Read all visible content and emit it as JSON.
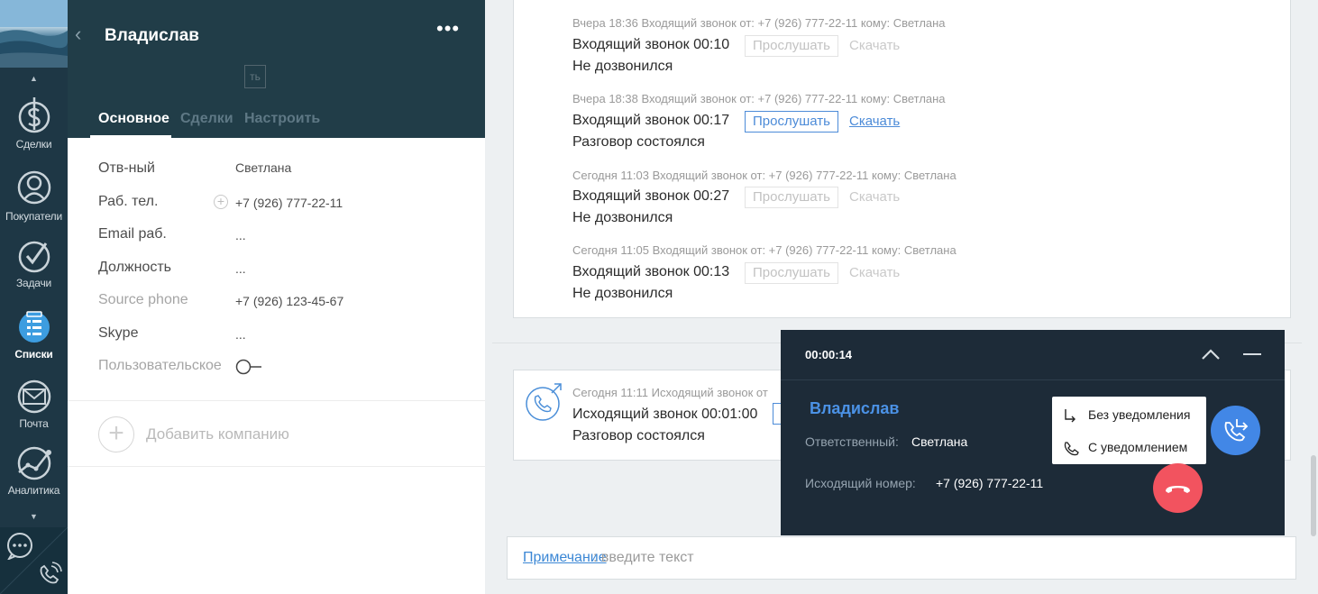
{
  "nav": {
    "items": [
      {
        "label": "Сделки",
        "icon": "dollar-icon"
      },
      {
        "label": "Покупатели",
        "icon": "customers-icon"
      },
      {
        "label": "Задачи",
        "icon": "tasks-icon"
      },
      {
        "label": "Списки",
        "icon": "lists-icon",
        "active": true
      },
      {
        "label": "Почта",
        "icon": "mail-icon"
      },
      {
        "label": "Аналитика",
        "icon": "analytics-icon"
      }
    ],
    "colors": {
      "bg": "#1e3745",
      "active_icon": "#3d9de0"
    }
  },
  "card": {
    "title": "Владислав",
    "ghost_button": "ть",
    "tabs": [
      "Основное",
      "Сделки",
      "Настроить"
    ],
    "fields": [
      {
        "label": "Отв-ный",
        "value": "Светлана"
      },
      {
        "label": "Раб. тел.",
        "value": "+7 (926) 777-22-11"
      },
      {
        "label": "Email раб.",
        "value": "..."
      },
      {
        "label": "Должность",
        "value": "..."
      },
      {
        "label": "Source phone",
        "value": "+7 (926) 123-45-67"
      },
      {
        "label": "Skype",
        "value": "..."
      },
      {
        "label": "Пользовательское",
        "value": ""
      }
    ],
    "add_company": "Добавить компанию"
  },
  "feed": {
    "calls": [
      {
        "meta": "Вчера 18:36 Входящий звонок от: +7 (926) 777-22-11 кому: Светлана",
        "title": "Входящий звонок 00:10",
        "listen": "Прослушать",
        "download": "Скачать",
        "status": "Не дозвонился",
        "active": false
      },
      {
        "meta": "Вчера 18:38 Входящий звонок от: +7 (926) 777-22-11 кому: Светлана",
        "title": "Входящий звонок 00:17",
        "listen": "Прослушать",
        "download": "Скачать",
        "status": "Разговор состоялся",
        "active": true
      },
      {
        "meta": "Сегодня 11:03 Входящий звонок от: +7 (926) 777-22-11 кому: Светлана",
        "title": "Входящий звонок 00:27",
        "listen": "Прослушать",
        "download": "Скачать",
        "status": "Не дозвонился",
        "active": false
      },
      {
        "meta": "Сегодня 11:05 Входящий звонок от: +7 (926) 777-22-11 кому: Светлана",
        "title": "Входящий звонок 00:13",
        "listen": "Прослушать",
        "download": "Скачать",
        "status": "Не дозвонился",
        "active": false
      }
    ],
    "outgoing": {
      "meta": "Сегодня 11:11 Исходящий звонок от",
      "title": "Исходящий звонок 00:01:00",
      "status": "Разговор состоялся"
    },
    "note": {
      "label": "Примечание",
      "placeholder": ": введите текст"
    }
  },
  "widget": {
    "timer": "00:00:14",
    "name": "Владислав",
    "responsible_label": "Ответственный:",
    "responsible_value": "Светлана",
    "number_label": "Исходящий номер:",
    "number_value": "+7 (926) 777-22-11",
    "menu": [
      "Без уведомления",
      "С уведомлением"
    ],
    "colors": {
      "bg": "#1d2b38",
      "name": "#4b92e6",
      "transfer": "#4287e6",
      "hangup": "#f2535f"
    }
  }
}
